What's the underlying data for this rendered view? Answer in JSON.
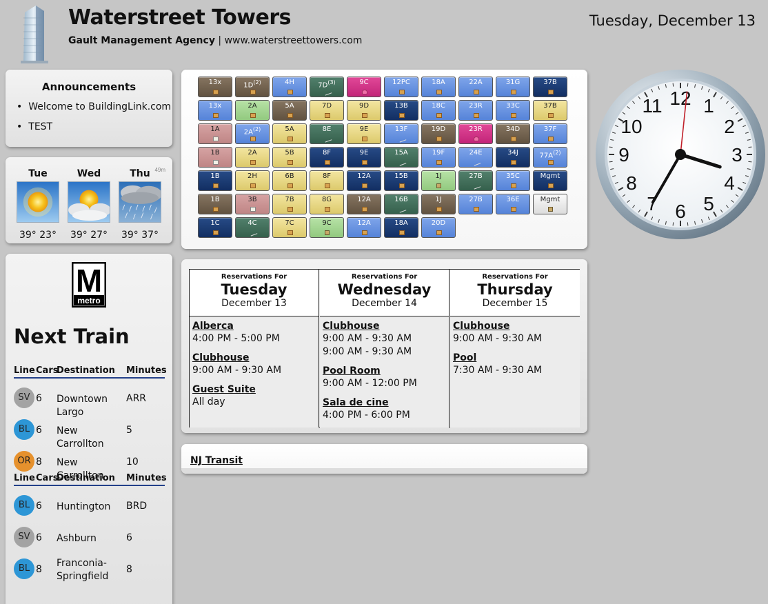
{
  "header": {
    "title": "Waterstreet Towers",
    "agency": "Gault Management Agency",
    "separator": "|",
    "website": "www.waterstreettowers.com",
    "date": "Tuesday, December 13"
  },
  "announcements": {
    "title": "Announcements",
    "items": [
      "Welcome to BuildingLink.com",
      "TEST"
    ]
  },
  "weather": {
    "note": "49m",
    "days": [
      {
        "day": "Tue",
        "temps": "39° 23°",
        "icon": "sunny-icon"
      },
      {
        "day": "Wed",
        "temps": "39° 27°",
        "icon": "partly-cloudy-icon"
      },
      {
        "day": "Thu",
        "temps": "39° 37°",
        "icon": "rain-icon"
      }
    ]
  },
  "metro": {
    "logo_letter": "M",
    "logo_text": "metro",
    "title": "Next Train",
    "headers": {
      "line": "Line",
      "cars": "Cars",
      "destination": "Destination",
      "minutes": "Minutes"
    },
    "groups": [
      [
        {
          "line": "SV",
          "color": "#a3a3a3",
          "cars": "6",
          "destination": "Downtown Largo",
          "minutes": "ARR"
        },
        {
          "line": "BL",
          "color": "#2d96d6",
          "cars": "6",
          "destination": "New Carrollton",
          "minutes": "5"
        },
        {
          "line": "OR",
          "color": "#e6912d",
          "cars": "8",
          "destination": "New Carrollton",
          "minutes": "10"
        }
      ],
      [
        {
          "line": "BL",
          "color": "#2d96d6",
          "cars": "6",
          "destination": "Huntington",
          "minutes": "BRD"
        },
        {
          "line": "SV",
          "color": "#a3a3a3",
          "cars": "6",
          "destination": "Ashburn",
          "minutes": "6"
        },
        {
          "line": "BL",
          "color": "#2d96d6",
          "cars": "8",
          "destination": "Franconia-Springfield",
          "minutes": "8"
        }
      ]
    ]
  },
  "mailboxes": [
    [
      {
        "u": "13x",
        "c": "br",
        "i": "box"
      },
      {
        "u": "1D",
        "s": "(2)",
        "c": "br",
        "i": "box"
      },
      {
        "u": "4H",
        "c": "lb",
        "i": "box"
      },
      {
        "u": "7D",
        "s": "(3)",
        "c": "gr",
        "i": "dc"
      },
      {
        "u": "9C",
        "c": "mg",
        "i": "fl"
      },
      {
        "u": "12PC",
        "c": "lb",
        "i": "box"
      },
      {
        "u": "18A",
        "c": "lb",
        "i": "box"
      },
      {
        "u": "22A",
        "c": "lb",
        "i": "box"
      },
      {
        "u": "31G",
        "c": "lb",
        "i": "box"
      },
      {
        "u": "37B",
        "c": "db",
        "i": "box"
      }
    ],
    [
      {
        "u": "13x",
        "c": "lb",
        "i": "box"
      },
      {
        "u": "2A",
        "c": "lg",
        "i": "box"
      },
      {
        "u": "5A",
        "c": "br",
        "i": "box"
      },
      {
        "u": "7D",
        "c": "yl",
        "i": "box"
      },
      {
        "u": "9D",
        "c": "yl",
        "i": "box"
      },
      {
        "u": "13B",
        "c": "db",
        "i": "box"
      },
      {
        "u": "18C",
        "c": "lb",
        "i": "box"
      },
      {
        "u": "23R",
        "c": "lb",
        "i": "box"
      },
      {
        "u": "33C",
        "c": "lb",
        "i": "box"
      },
      {
        "u": "37B",
        "c": "yl",
        "i": "box"
      }
    ],
    [
      {
        "u": "1A",
        "c": "pk",
        "i": "note"
      },
      {
        "u": "2A",
        "s": "(2)",
        "c": "lb",
        "i": "box"
      },
      {
        "u": "5A",
        "c": "yl",
        "i": "box"
      },
      {
        "u": "8E",
        "c": "gr",
        "i": "dc"
      },
      {
        "u": "9E",
        "c": "yl",
        "i": "box"
      },
      {
        "u": "13F",
        "c": "lb",
        "i": "dc"
      },
      {
        "u": "19D",
        "c": "br",
        "i": "box"
      },
      {
        "u": "23R",
        "c": "mg",
        "i": "fl"
      },
      {
        "u": "34D",
        "c": "br",
        "i": "box"
      },
      {
        "u": "37F",
        "c": "lb",
        "i": "box"
      }
    ],
    [
      {
        "u": "1B",
        "c": "pk",
        "i": "note"
      },
      {
        "u": "2A",
        "c": "yl",
        "i": "box"
      },
      {
        "u": "5B",
        "c": "yl",
        "i": "box"
      },
      {
        "u": "8F",
        "c": "db",
        "i": "box"
      },
      {
        "u": "9E",
        "c": "db",
        "i": "box"
      },
      {
        "u": "15A",
        "c": "gr",
        "i": "dc"
      },
      {
        "u": "19F",
        "c": "lb",
        "i": "box"
      },
      {
        "u": "24E",
        "c": "lb",
        "i": "dc"
      },
      {
        "u": "34J",
        "c": "db",
        "i": "box"
      },
      {
        "u": "77A",
        "s": "(2)",
        "c": "lb",
        "i": "box"
      }
    ],
    [
      {
        "u": "1B",
        "c": "db",
        "i": "box"
      },
      {
        "u": "2H",
        "c": "yl",
        "i": "box"
      },
      {
        "u": "6B",
        "c": "yl",
        "i": "box"
      },
      {
        "u": "8F",
        "c": "yl",
        "i": "box"
      },
      {
        "u": "12A",
        "c": "db",
        "i": "box"
      },
      {
        "u": "15B",
        "c": "db",
        "i": "box"
      },
      {
        "u": "1J",
        "c": "lg",
        "i": "bag"
      },
      {
        "u": "27B",
        "c": "gr",
        "i": "dc"
      },
      {
        "u": "35C",
        "c": "lb",
        "i": "box"
      },
      {
        "u": "Mgmt",
        "c": "db",
        "i": "box"
      }
    ],
    [
      {
        "u": "1B",
        "c": "br",
        "i": "box"
      },
      {
        "u": "3B",
        "c": "pk",
        "i": "note"
      },
      {
        "u": "7B",
        "c": "yl",
        "i": "box"
      },
      {
        "u": "8G",
        "c": "yl",
        "i": "box"
      },
      {
        "u": "12A",
        "c": "br",
        "i": "box"
      },
      {
        "u": "16B",
        "c": "gr",
        "i": "dc"
      },
      {
        "u": "1J",
        "c": "br",
        "i": "box"
      },
      {
        "u": "27B",
        "c": "lb",
        "i": "box"
      },
      {
        "u": "36E",
        "c": "lb",
        "i": "box"
      },
      {
        "u": "Mgmt",
        "c": "wt",
        "i": "bag"
      }
    ],
    [
      {
        "u": "1C",
        "c": "db",
        "i": "box"
      },
      {
        "u": "4C",
        "c": "gr",
        "i": "dc"
      },
      {
        "u": "7C",
        "c": "yl",
        "i": "box"
      },
      {
        "u": "9C",
        "c": "lg",
        "i": "bag"
      },
      {
        "u": "12A",
        "c": "lb",
        "i": "box"
      },
      {
        "u": "18A",
        "c": "db",
        "i": "box"
      },
      {
        "u": "20D",
        "c": "lb",
        "i": "box"
      }
    ]
  ],
  "reservations": {
    "label": "Reservations For",
    "days": [
      {
        "day": "Tuesday",
        "date": "December 13",
        "items": [
          {
            "name": "Alberca",
            "times": [
              "4:00 PM - 5:00 PM"
            ]
          },
          {
            "name": "Clubhouse",
            "times": [
              "9:00 AM - 9:30 AM"
            ]
          },
          {
            "name": "Guest Suite",
            "times": [
              "All day"
            ]
          }
        ]
      },
      {
        "day": "Wednesday",
        "date": "December 14",
        "items": [
          {
            "name": "Clubhouse",
            "times": [
              "9:00 AM - 9:30 AM",
              "9:00 AM - 9:30 AM"
            ]
          },
          {
            "name": "Pool Room",
            "times": [
              "9:00 AM - 12:00 PM"
            ]
          },
          {
            "name": "Sala de cine",
            "times": [
              "4:00 PM - 6:00 PM"
            ]
          }
        ]
      },
      {
        "day": "Thursday",
        "date": "December 15",
        "items": [
          {
            "name": "Clubhouse",
            "times": [
              "9:00 AM - 9:30 AM"
            ]
          },
          {
            "name": "Pool",
            "times": [
              "7:30 AM - 9:30 AM"
            ]
          }
        ]
      }
    ]
  },
  "nj_transit": {
    "label": "NJ Transit"
  },
  "clock": {
    "numerals": [
      "12",
      "1",
      "2",
      "3",
      "4",
      "5",
      "6",
      "7",
      "8",
      "9",
      "10",
      "11"
    ],
    "hour": 3,
    "minute": 35,
    "second": 1
  },
  "colors": {
    "background": "#c6c6c6",
    "metro_rule": "#23408a",
    "second_hand": "#c0202a"
  }
}
